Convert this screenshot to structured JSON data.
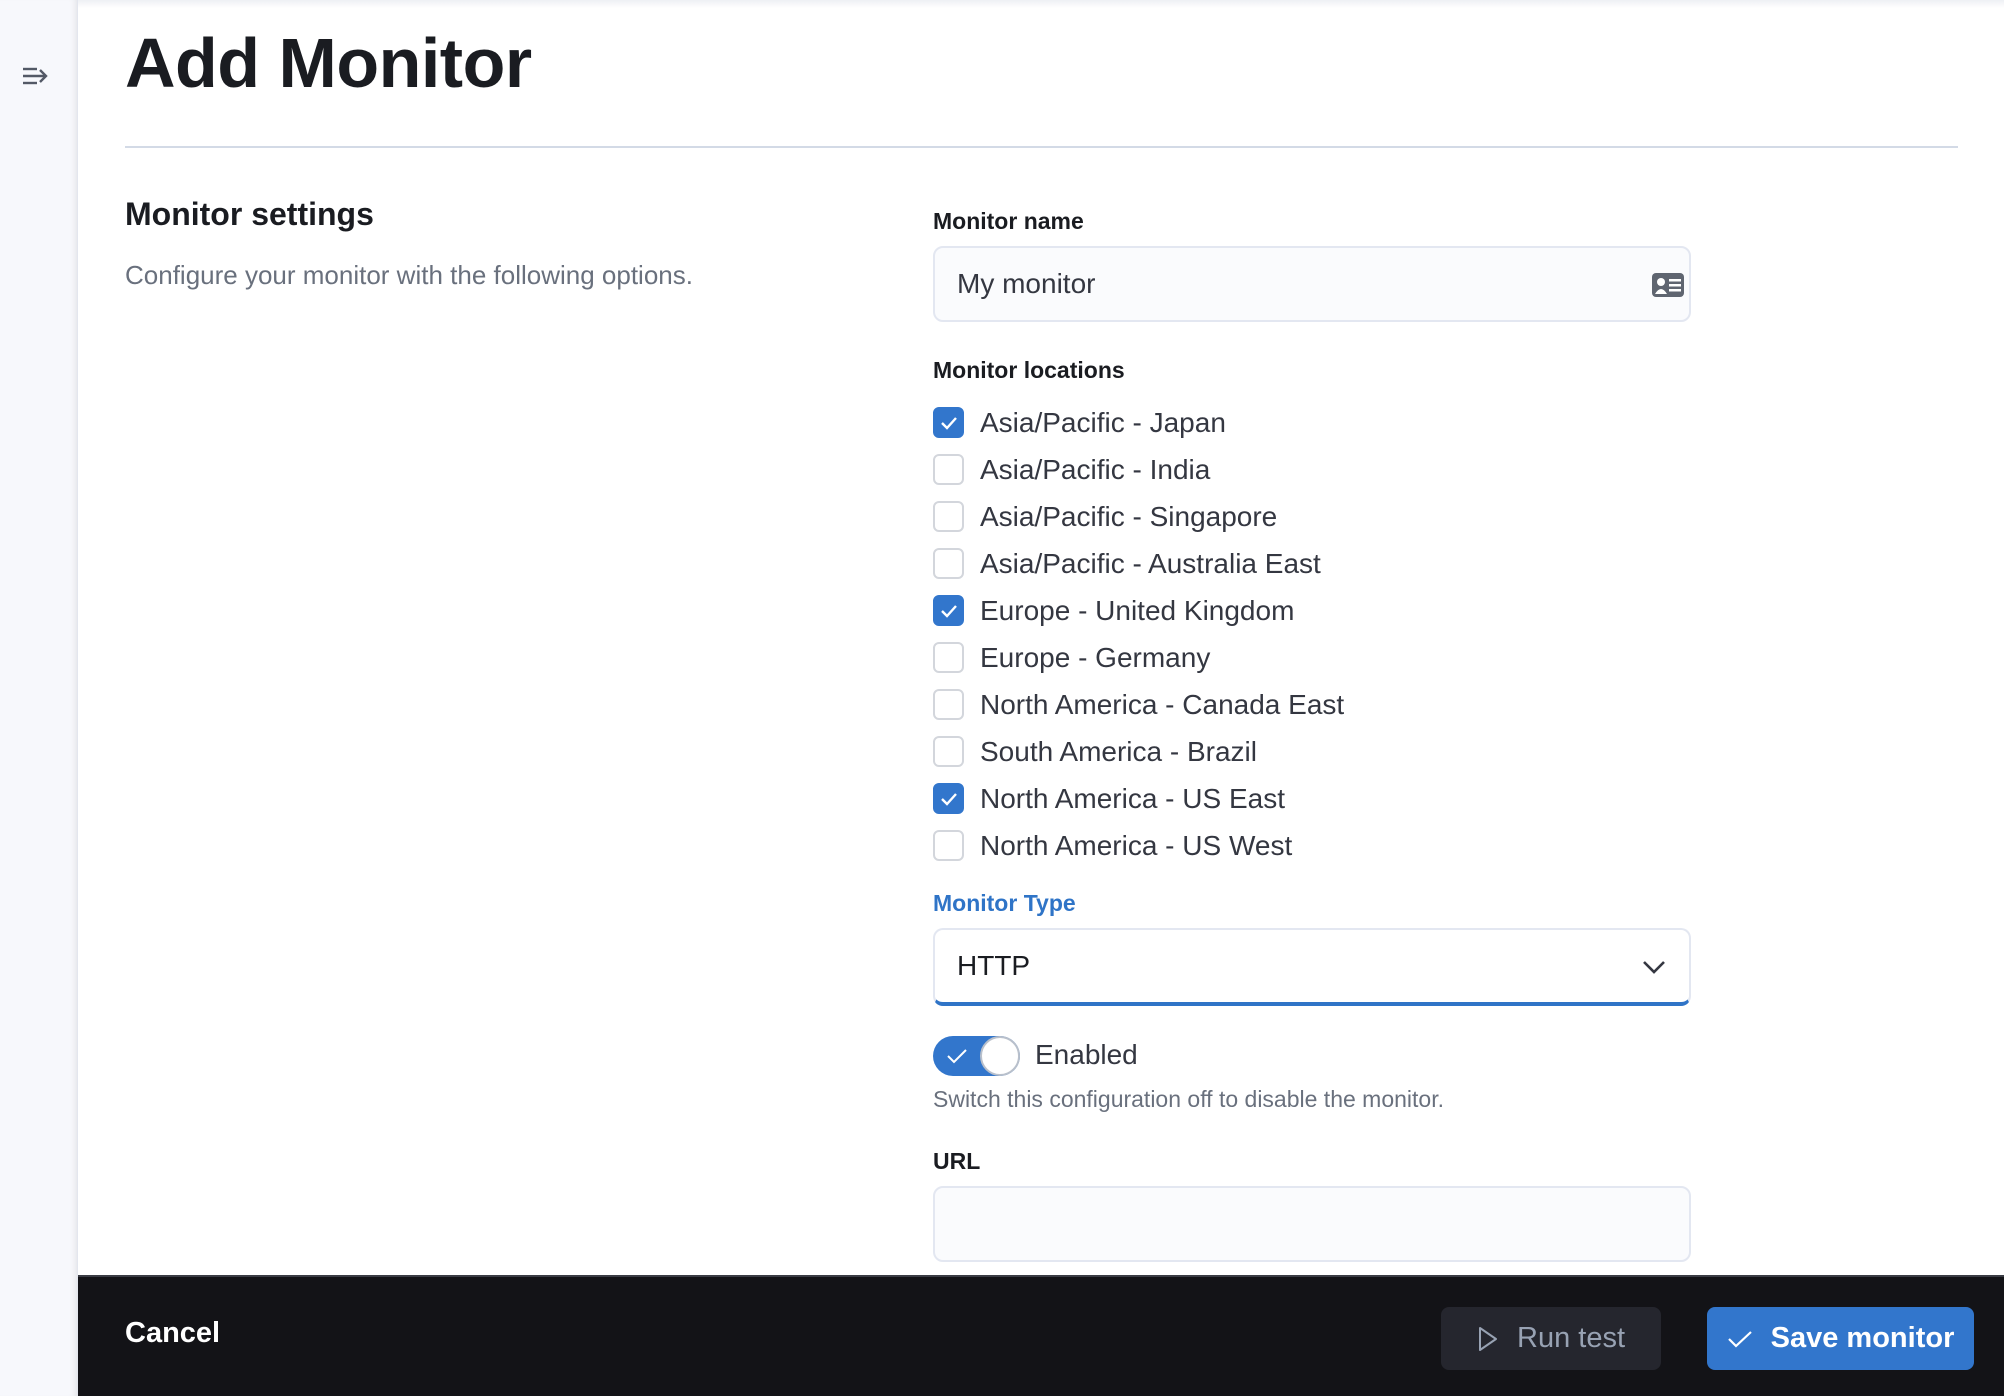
{
  "page": {
    "title": "Add Monitor"
  },
  "sidebar": {
    "toggle_icon": "menu-expand-icon"
  },
  "section": {
    "title": "Monitor settings",
    "description": "Configure your monitor with the following options."
  },
  "form": {
    "monitor_name": {
      "label": "Monitor name",
      "value": "My monitor",
      "icon": "contact-card-icon"
    },
    "locations": {
      "label": "Monitor locations",
      "items": [
        {
          "label": "Asia/Pacific - Japan",
          "checked": true
        },
        {
          "label": "Asia/Pacific - India",
          "checked": false
        },
        {
          "label": "Asia/Pacific - Singapore",
          "checked": false
        },
        {
          "label": "Asia/Pacific - Australia East",
          "checked": false
        },
        {
          "label": "Europe - United Kingdom",
          "checked": true
        },
        {
          "label": "Europe - Germany",
          "checked": false
        },
        {
          "label": "North America - Canada East",
          "checked": false
        },
        {
          "label": "South America - Brazil",
          "checked": false
        },
        {
          "label": "North America - US East",
          "checked": true
        },
        {
          "label": "North America - US West",
          "checked": false
        }
      ]
    },
    "monitor_type": {
      "label": "Monitor Type",
      "selected": "HTTP"
    },
    "enabled": {
      "label": "Enabled",
      "on": true,
      "help": "Switch this configuration off to disable the monitor."
    },
    "url": {
      "label": "URL",
      "value": "",
      "placeholder": ""
    }
  },
  "footer": {
    "cancel_label": "Cancel",
    "run_test_label": "Run test",
    "save_label": "Save monitor"
  },
  "colors": {
    "accent": "#3276cc",
    "footer_bg": "#131317",
    "run_button_bg": "#25262e"
  }
}
